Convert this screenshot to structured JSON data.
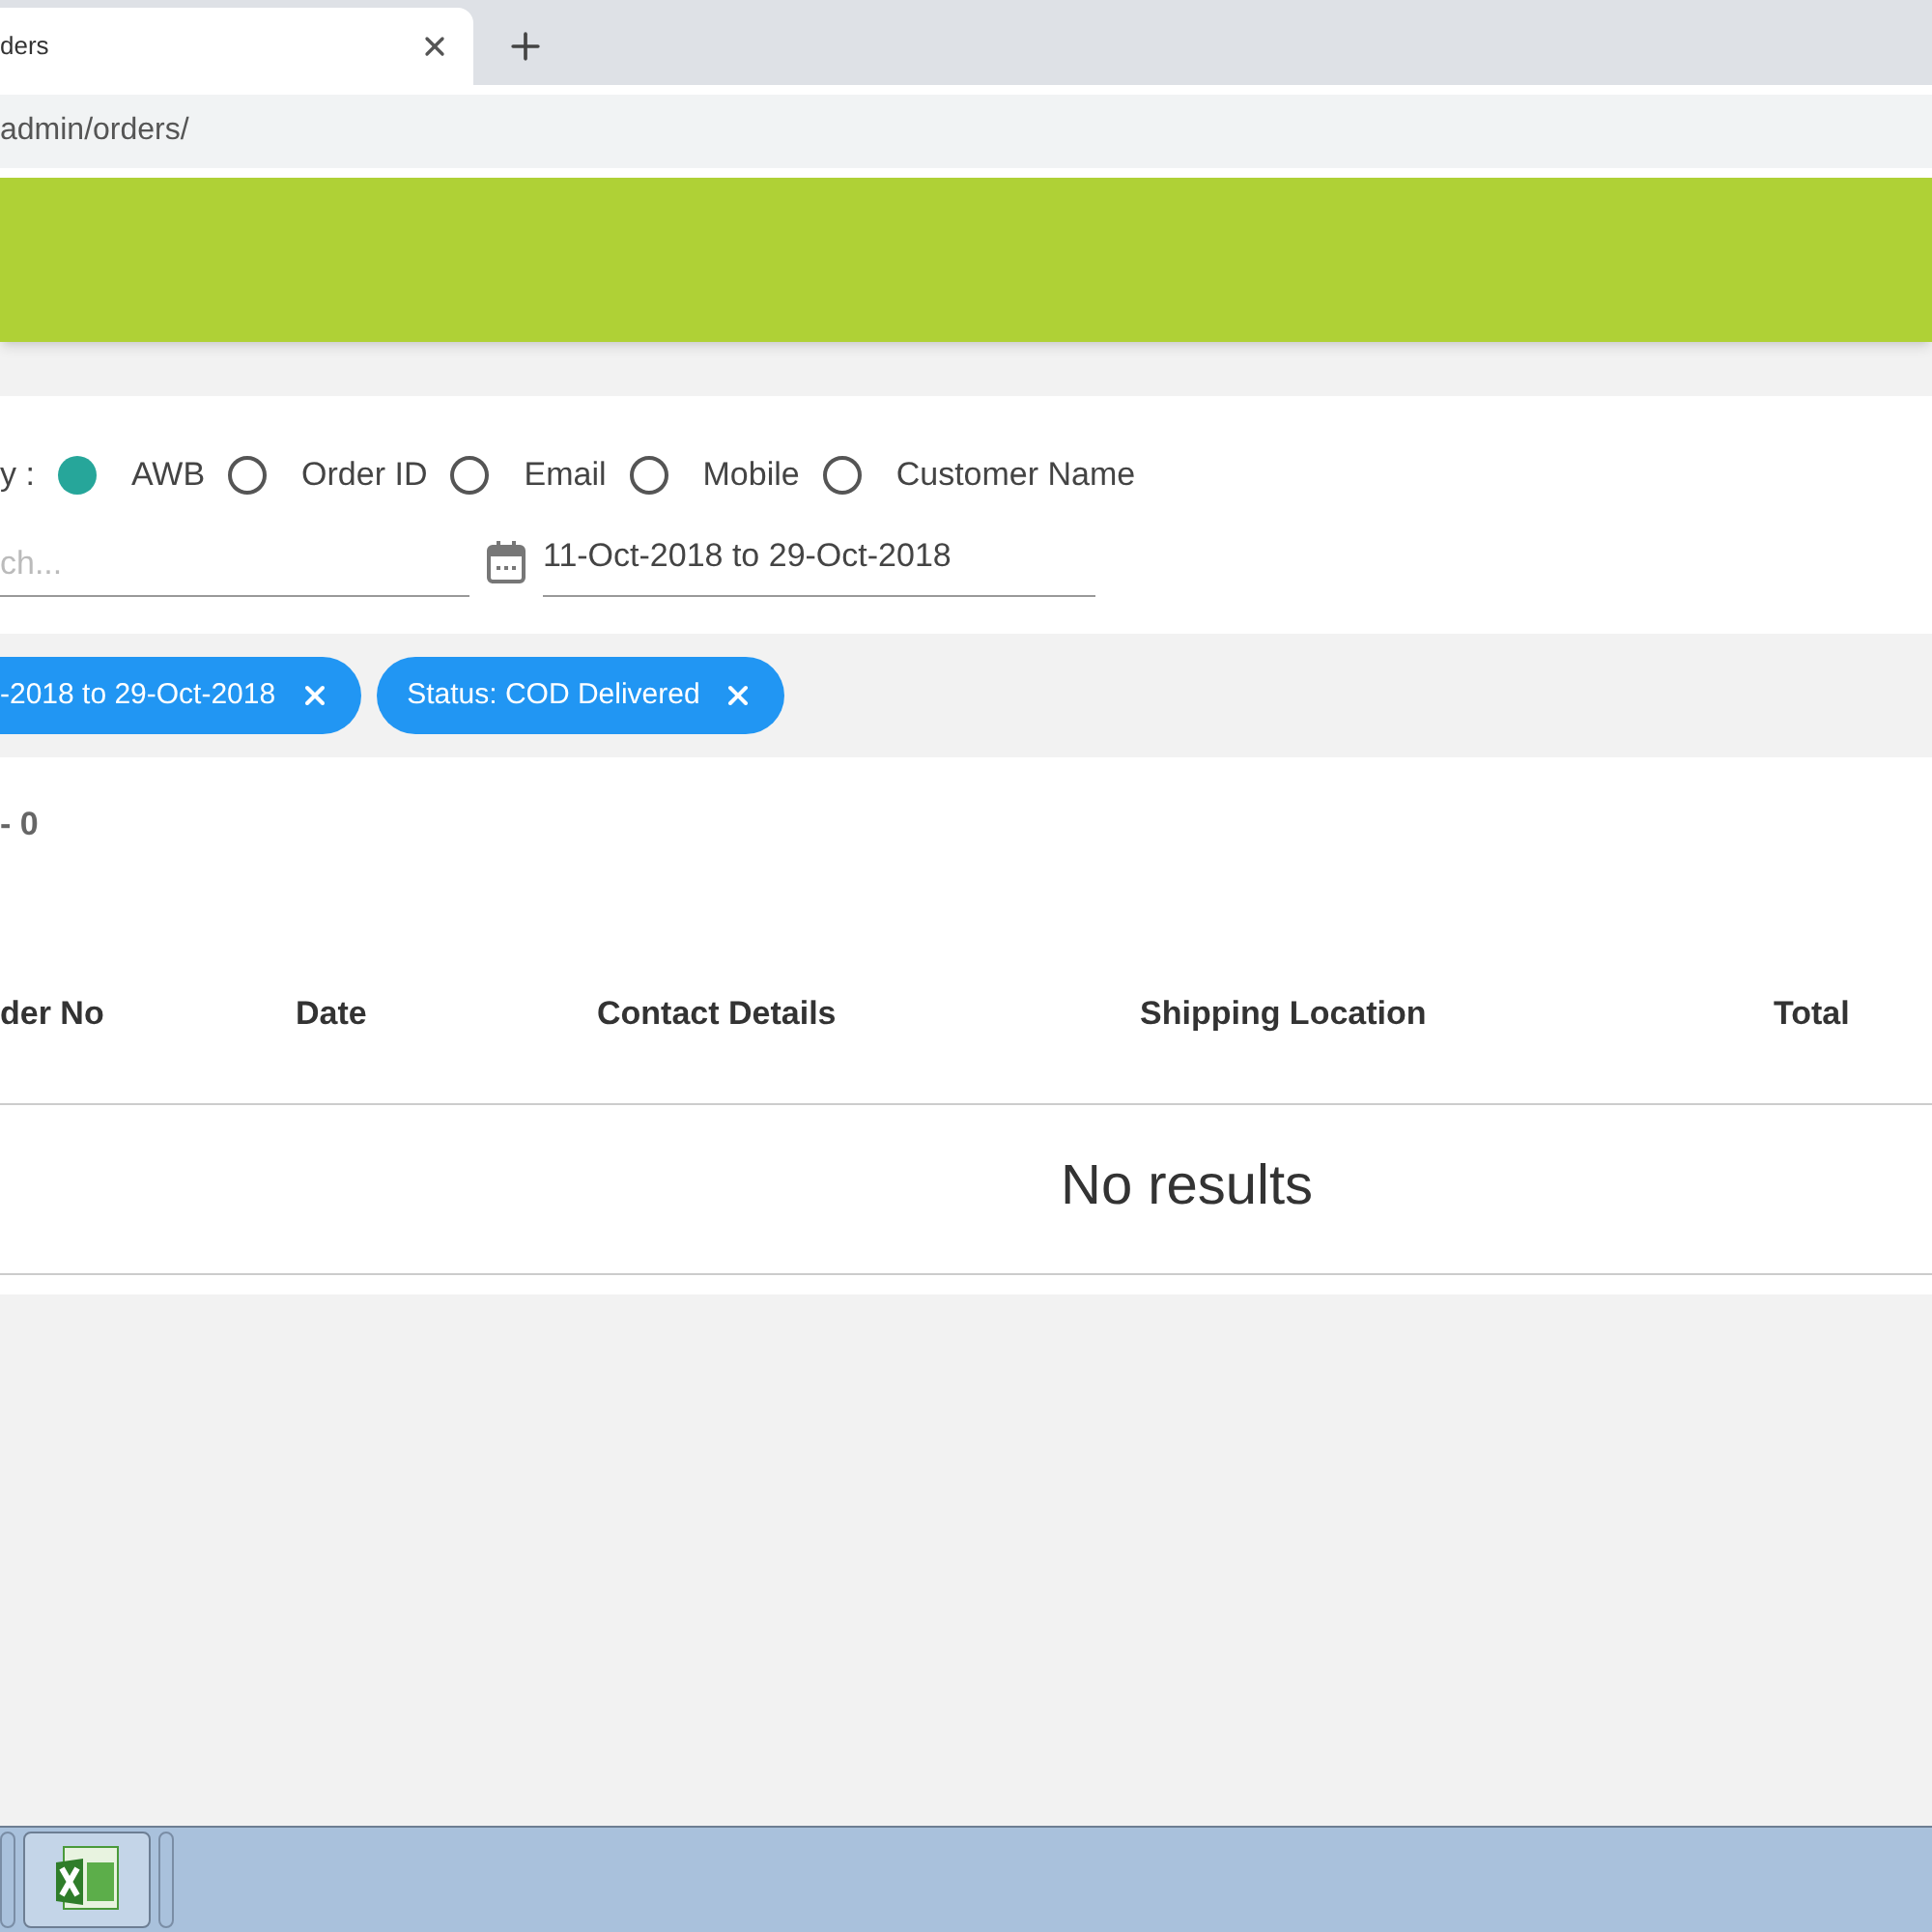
{
  "browser": {
    "tab_title": "ders",
    "address": "admin/orders/"
  },
  "search_by": {
    "label": "y :",
    "options": [
      {
        "label": "AWB",
        "selected": true
      },
      {
        "label": "Order ID",
        "selected": false
      },
      {
        "label": "Email",
        "selected": false
      },
      {
        "label": "Mobile",
        "selected": false
      },
      {
        "label": "Customer Name",
        "selected": false
      }
    ]
  },
  "search": {
    "placeholder": "ch..."
  },
  "date_range": {
    "value": "11-Oct-2018 to 29-Oct-2018"
  },
  "filter_chips": [
    "-2018 to 29-Oct-2018",
    "Status: COD Delivered"
  ],
  "count": "- 0",
  "table": {
    "columns": [
      "der No",
      "Date",
      "Contact Details",
      "Shipping Location",
      "Total"
    ],
    "empty_message": "No results"
  }
}
